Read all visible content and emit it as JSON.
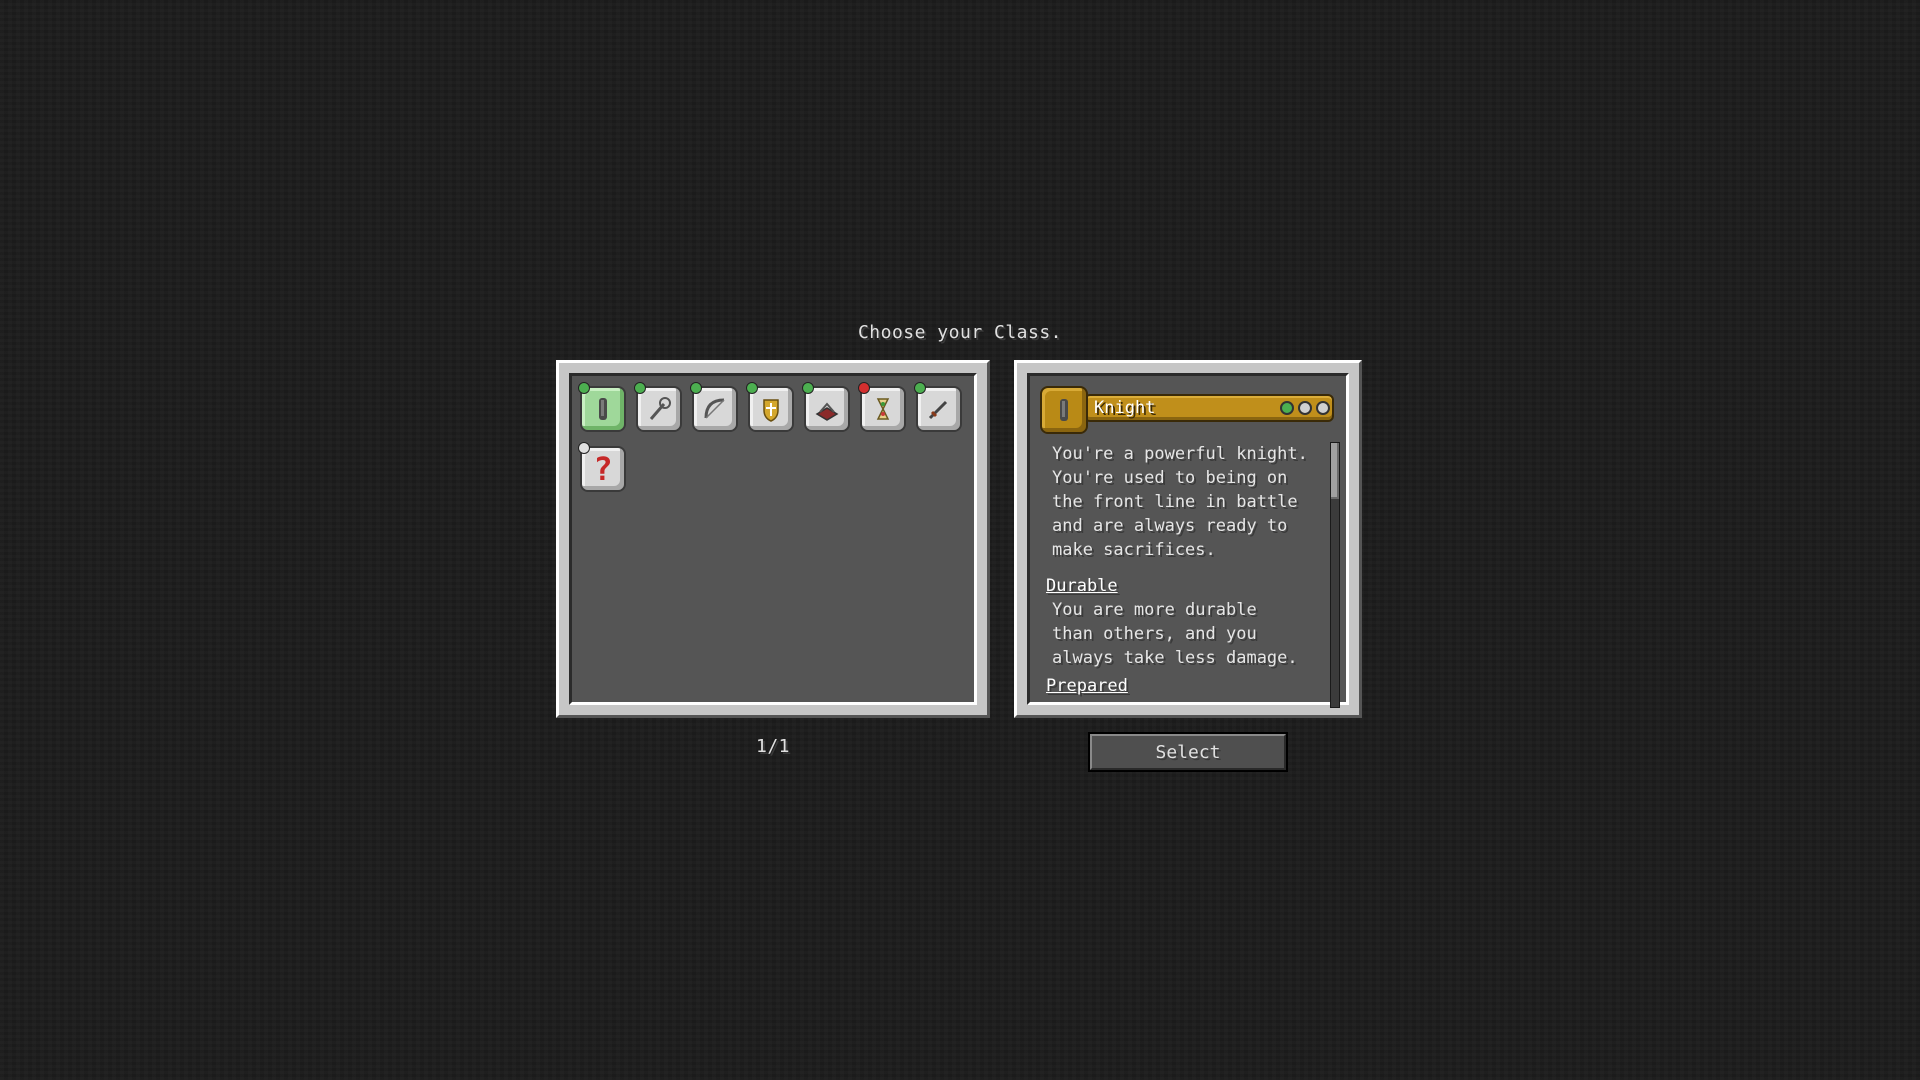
{
  "title": "Choose your Class.",
  "class_list": {
    "page_indicator": "1/1",
    "icons": [
      {
        "name": "knight-class-icon",
        "selected": true,
        "pip_color": "#4caf50"
      },
      {
        "name": "alchemist-class-icon",
        "selected": false,
        "pip_color": "#4caf50"
      },
      {
        "name": "archer-class-icon",
        "selected": false,
        "pip_color": "#4caf50"
      },
      {
        "name": "paladin-class-icon",
        "selected": false,
        "pip_color": "#4caf50"
      },
      {
        "name": "mage-class-icon",
        "selected": false,
        "pip_color": "#4caf50"
      },
      {
        "name": "hourglass-class-icon",
        "selected": false,
        "pip_color": "#d32f2f"
      },
      {
        "name": "assassin-class-icon",
        "selected": false,
        "pip_color": "#4caf50"
      },
      {
        "name": "random-class-icon",
        "selected": false,
        "pip_color": "#e0e0e0"
      }
    ]
  },
  "details": {
    "class_name": "Knight",
    "difficulty_dots": [
      "#4caf50",
      "#d0d0d0",
      "#d0d0d0"
    ],
    "description_lines": [
      "You're a powerful knight.",
      "You're used to being on",
      "the front line in battle",
      "and are always ready to",
      "make sacrifices."
    ],
    "perks": [
      {
        "title": "Durable",
        "lines": [
          "You are more durable",
          "than others, and you",
          "always take less damage."
        ]
      },
      {
        "title": "Prepared",
        "lines": []
      }
    ]
  },
  "select_button_label": "Select",
  "colors": {
    "selected_icon": "#9fd89a",
    "header_gold": "#c08f1b",
    "panel_gray": "#555555"
  }
}
